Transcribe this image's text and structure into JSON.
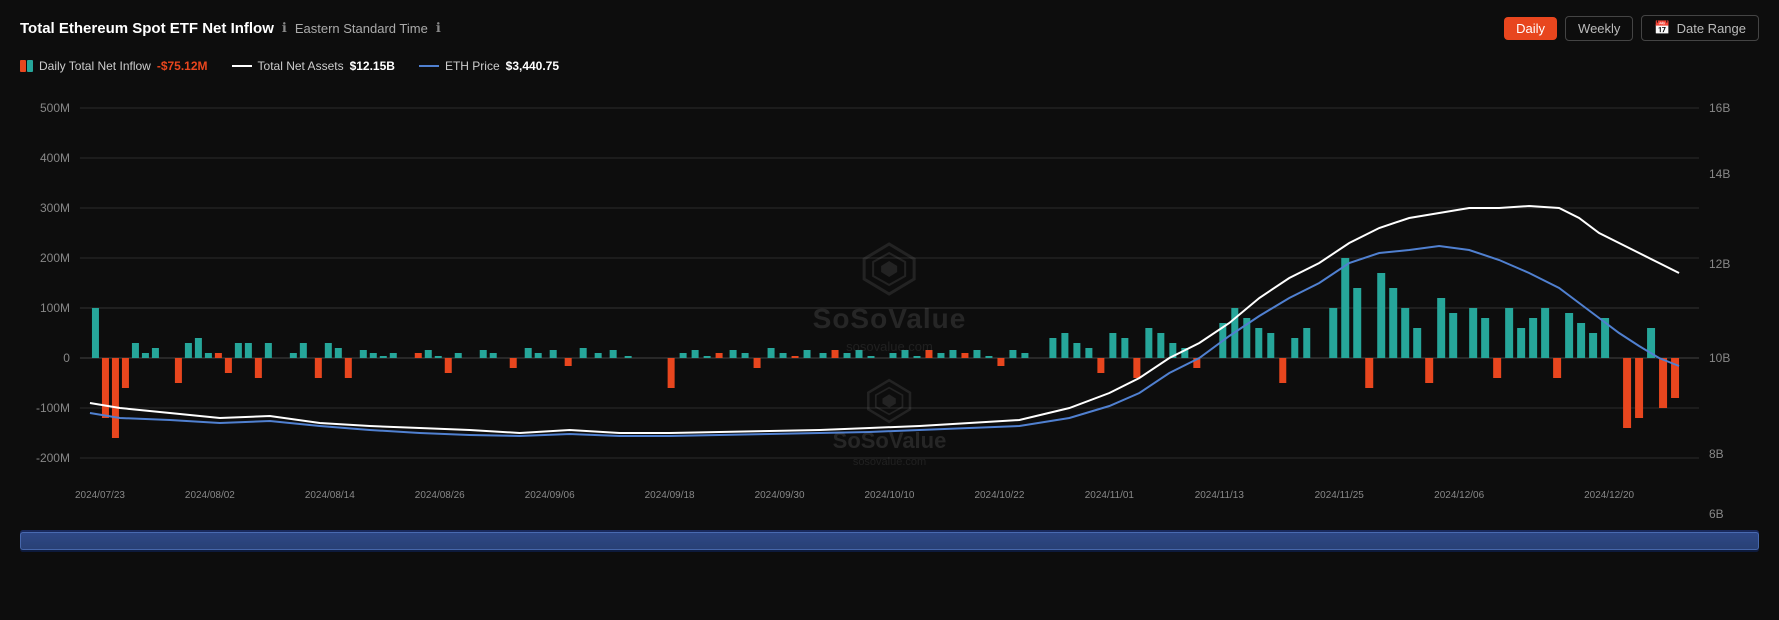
{
  "header": {
    "title": "Total Ethereum Spot ETF Net Inflow",
    "timezone": "Eastern Standard Time",
    "info_icon": "ℹ",
    "info_icon2": "ℹ"
  },
  "controls": {
    "daily_label": "Daily",
    "weekly_label": "Weekly",
    "date_range_label": "Date Range",
    "calendar_icon": "📅"
  },
  "legend": {
    "net_inflow_label": "Daily Total Net Inflow",
    "net_inflow_value": "-$75.12M",
    "total_assets_label": "Total Net Assets",
    "total_assets_value": "$12.15B",
    "eth_price_label": "ETH Price",
    "eth_price_value": "$3,440.75"
  },
  "chart": {
    "y_axis_left": [
      "500M",
      "400M",
      "300M",
      "200M",
      "100M",
      "0",
      "-100M",
      "-200M"
    ],
    "y_axis_right": [
      "16B",
      "14B",
      "12B",
      "10B",
      "8B",
      "6B"
    ],
    "x_axis_dates": [
      "2024/07/23",
      "2024/08/02",
      "2024/08/14",
      "2024/08/26",
      "2024/09/06",
      "2024/09/18",
      "2024/09/30",
      "2024/10/10",
      "2024/10/22",
      "2024/11/01",
      "2024/11/13",
      "2024/11/25",
      "2024/12/06",
      "2024/12/20"
    ],
    "watermark_brand": "SoSoValue",
    "watermark_url": "sosovalue.com"
  }
}
